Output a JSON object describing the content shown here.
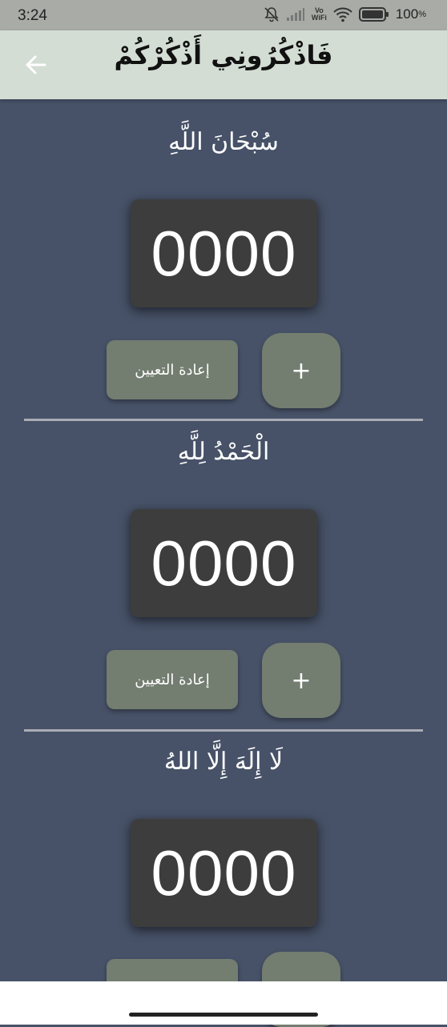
{
  "status_bar": {
    "time": "3:24",
    "icons": [
      "mute-icon",
      "signal-icon",
      "vowifi-icon",
      "wifi-icon",
      "battery-icon"
    ],
    "vowifi_top": "Vo",
    "vowifi_bottom": "WiFi",
    "battery": "100",
    "battery_unit": "%"
  },
  "app_bar": {
    "title": "فَاذْكُرُونِي أَذْكُرْكُمْ",
    "back_icon": "arrow-left-icon",
    "background": "#d3ddd4"
  },
  "colors": {
    "page_background": "#475268",
    "counter_background": "#3d3d3d",
    "button_background": "#737d70"
  },
  "sections": [
    {
      "dhikr": "سُبْحَانَ اللَّهِ",
      "count": "0000",
      "reset_label": "إعادة التعيين",
      "plus_label": "+"
    },
    {
      "dhikr": "الْحَمْدُ لِلَّهِ",
      "count": "0000",
      "reset_label": "إعادة التعيين",
      "plus_label": "+"
    },
    {
      "dhikr": "لَا إِلَهَ إِلَّا اللهُ",
      "count": "0000",
      "reset_label": "",
      "plus_label": ""
    }
  ]
}
